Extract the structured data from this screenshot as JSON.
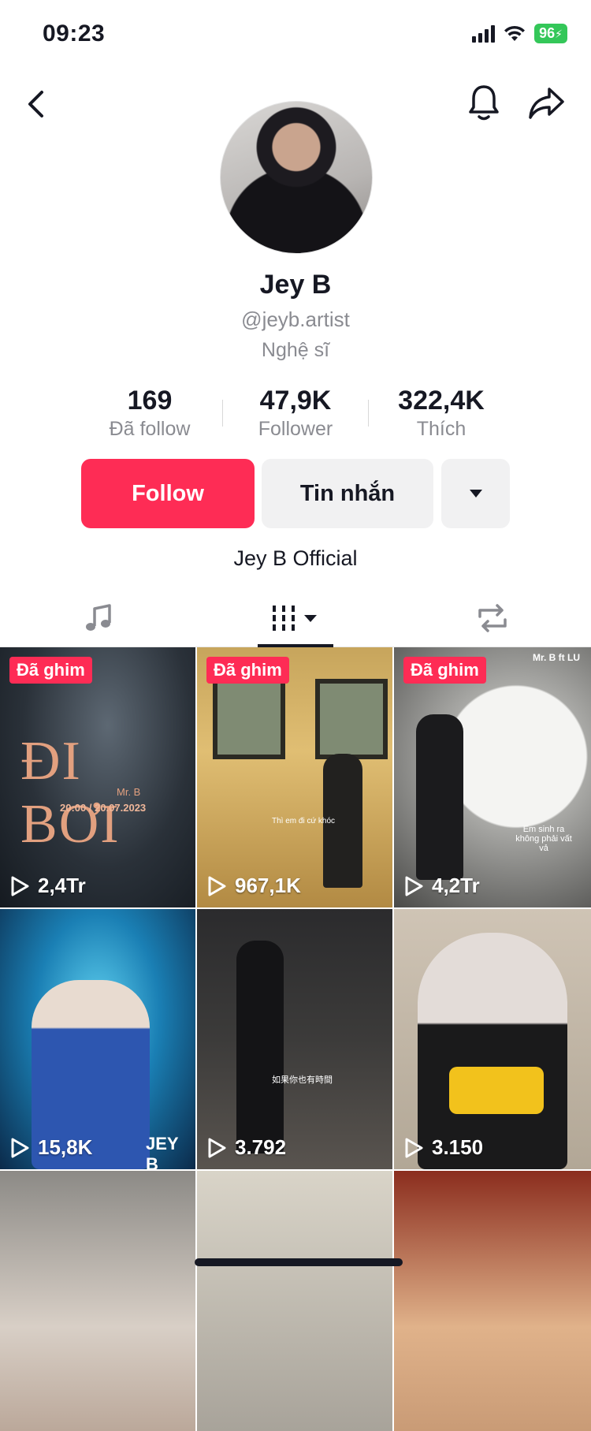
{
  "status_bar": {
    "time": "09:23",
    "battery": "96"
  },
  "header": {
    "back_icon": "chevron-left-icon",
    "bell_icon": "bell-icon",
    "share_icon": "share-arrow-icon"
  },
  "profile": {
    "name": "Jey B",
    "handle": "@jeyb.artist",
    "role": "Nghệ sĩ",
    "stats": [
      {
        "value": "169",
        "label": "Đã follow"
      },
      {
        "value": "47,9K",
        "label": "Follower"
      },
      {
        "value": "322,4K",
        "label": "Thích"
      }
    ],
    "follow_label": "Follow",
    "message_label": "Tin nhắn",
    "bio": "Jey B Official"
  },
  "tabs": [
    "music-note-icon",
    "videos-grid-icon",
    "repost-icon"
  ],
  "videos": [
    {
      "views": "2,4Tr",
      "pinned": "Đã ghim",
      "title": "ĐI BƠI",
      "subtitle": "Mr. B",
      "time": "20:00 / 20.07.2023"
    },
    {
      "views": "967,1K",
      "pinned": "Đã ghim",
      "caption": "Thì em đi cứ khóc"
    },
    {
      "views": "4,2Tr",
      "pinned": "Đã ghim",
      "top_text": "Mr. B ft LU",
      "caption": "Em sinh ra không phải vất vả"
    },
    {
      "views": "15,8K",
      "caption": "JEY B"
    },
    {
      "views": "3.792",
      "caption": "如果你也有時間"
    },
    {
      "views": "3.150"
    },
    {
      "views": ""
    },
    {
      "views": ""
    },
    {
      "views": ""
    }
  ],
  "colors": {
    "accent": "#fe2c55",
    "text": "#161823",
    "muted": "#8a8b91",
    "button_gray": "#f1f1f2"
  }
}
